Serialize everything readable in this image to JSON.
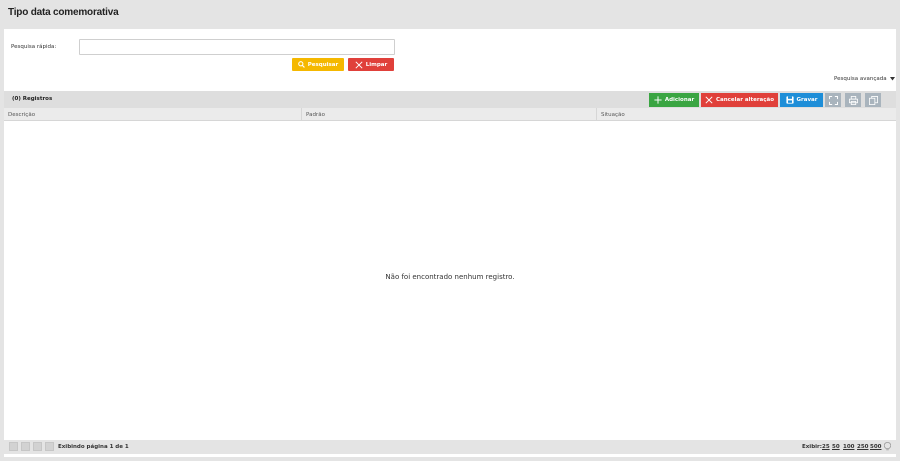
{
  "header": {
    "title": "Tipo data comemorativa"
  },
  "search": {
    "label": "Pesquisa rápida:",
    "value": "",
    "placeholder": "",
    "search_button": "Pesquisar",
    "clear_button": "Limpar",
    "advanced_label": "Pesquisa avançada"
  },
  "toolbar": {
    "records": "(0) Registros",
    "add": "Adicionar",
    "cancel": "Cancelar alteração",
    "save": "Gravar",
    "icons": [
      "expand-icon",
      "print-icon",
      "copy-icon"
    ]
  },
  "table": {
    "columns": [
      "Descrição",
      "Padrão",
      "Situação"
    ],
    "rows": [],
    "empty_message": "Não foi encontrado nenhum registro."
  },
  "footer": {
    "page_info": "Exibindo página 1 de 1",
    "show_label": "Exibir:",
    "page_sizes": [
      "25",
      "50",
      "100",
      "250",
      "500"
    ]
  },
  "colors": {
    "warning": "#f5b800",
    "danger": "#e0403a",
    "success": "#3aa542",
    "primary": "#1e8ed8",
    "muted": "#a9b4bd"
  }
}
